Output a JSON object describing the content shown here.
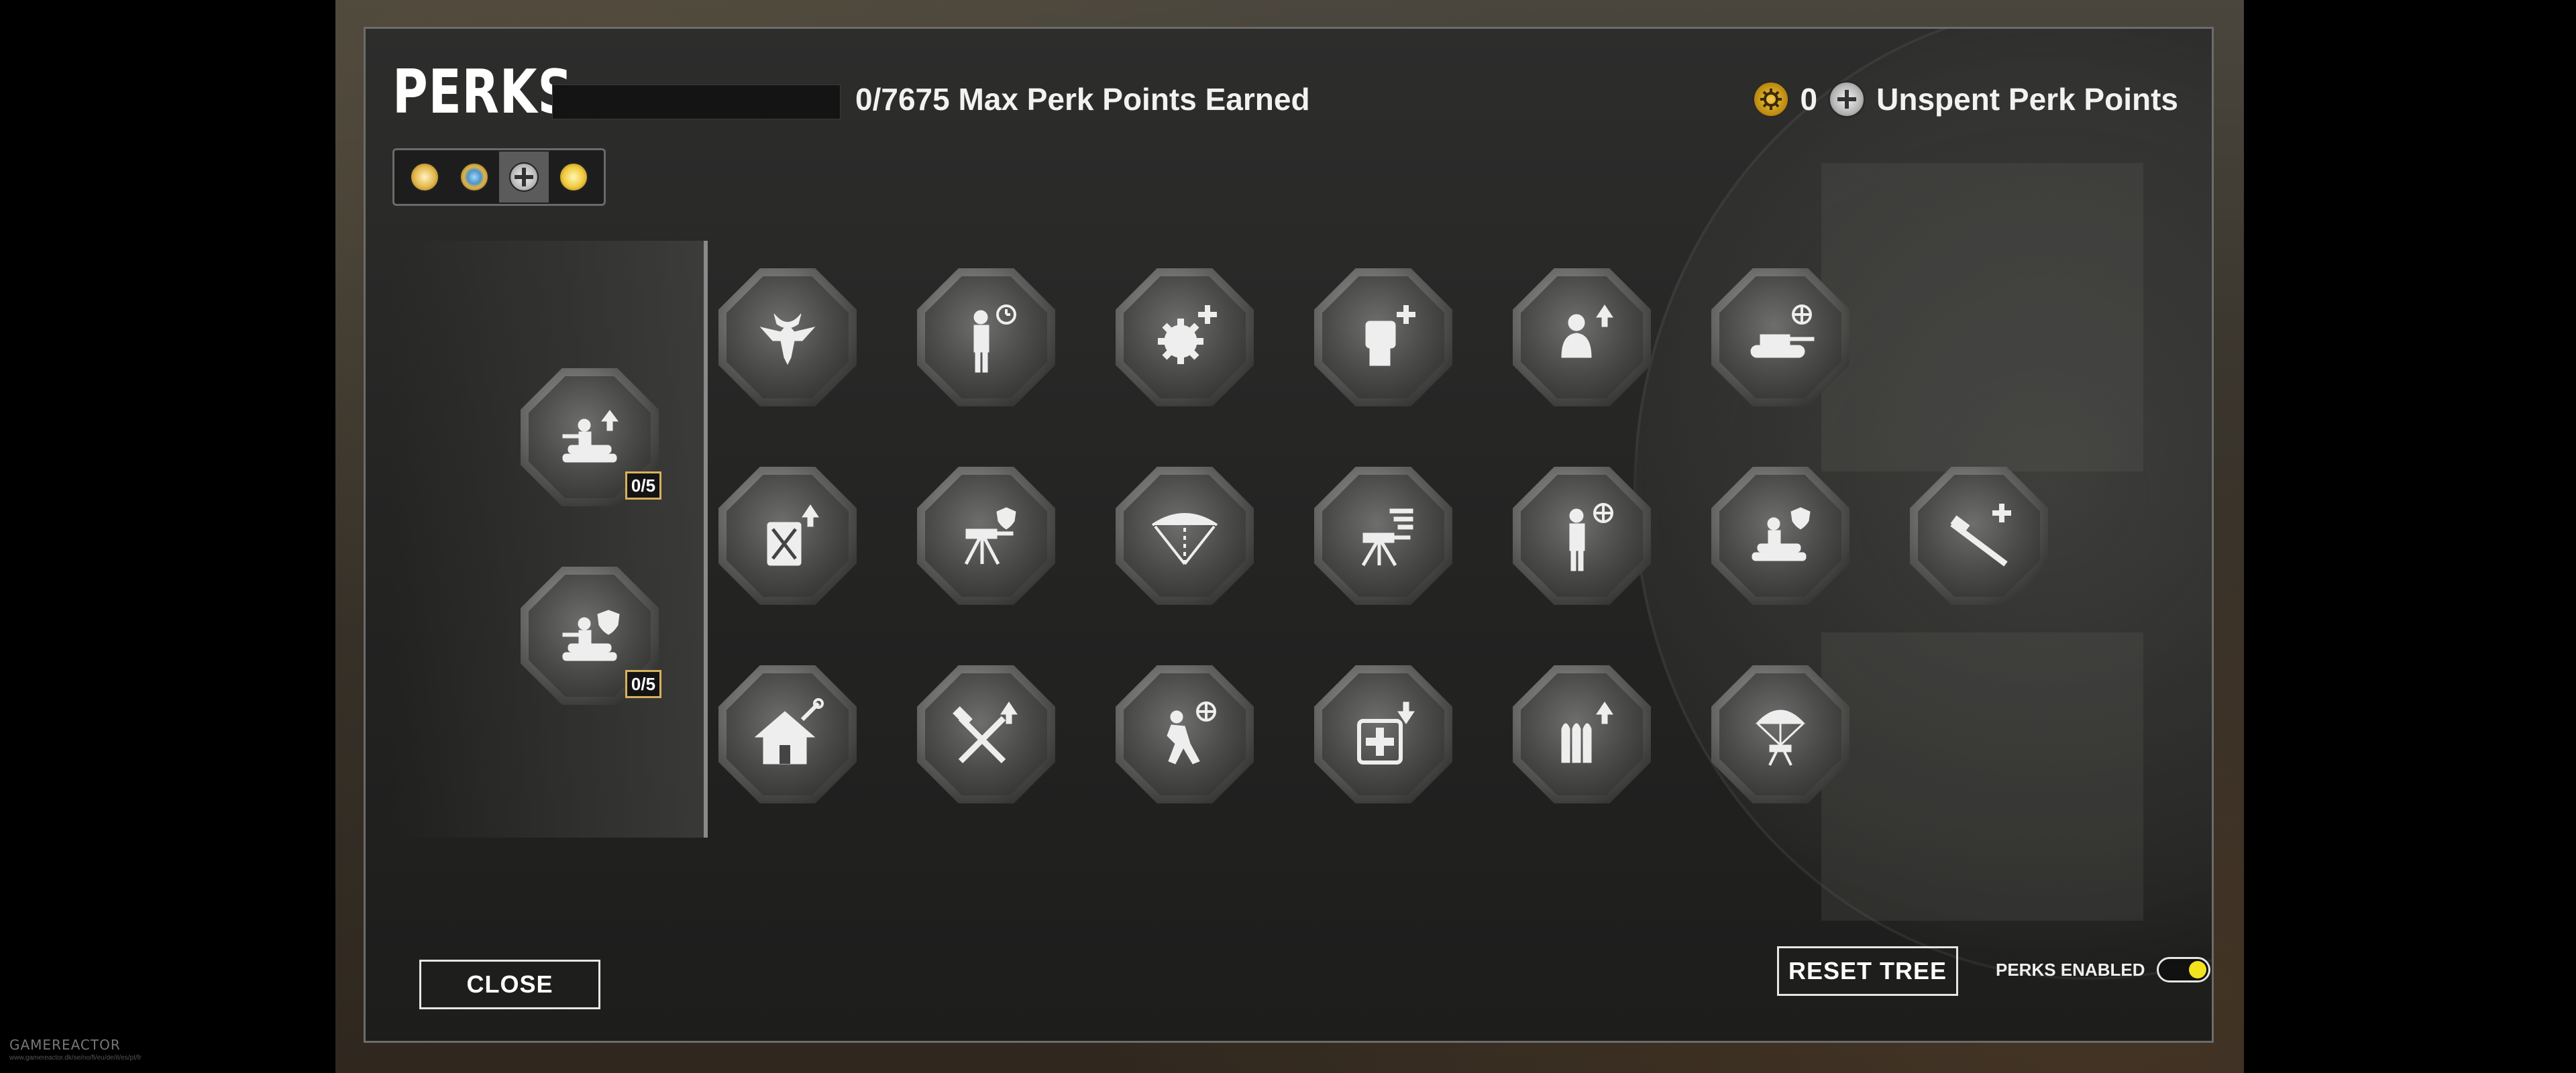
{
  "header": {
    "title": "PERKS",
    "progress_text": "0/7675 Max Perk Points Earned",
    "progress_fraction": 0,
    "general_points": "0",
    "unspent_label": "Unspent Perk Points"
  },
  "faction_tabs": [
    {
      "name": "faction-1",
      "active": false
    },
    {
      "name": "faction-2",
      "active": false
    },
    {
      "name": "faction-3",
      "active": true
    },
    {
      "name": "faction-4",
      "active": false
    }
  ],
  "sidebar_perks": [
    {
      "icon": "sandbag-soldier-upgrade-icon",
      "count": "0/5"
    },
    {
      "icon": "sandbag-soldier-shield-icon",
      "count": "0/5"
    }
  ],
  "perk_grid": {
    "row1": [
      "eagle-emblem-icon",
      "soldier-timer-icon",
      "gear-plus-icon",
      "fist-plus-icon",
      "soldier-upgrade-icon",
      "tank-target-icon"
    ],
    "row2": [
      "fuel-can-upgrade-icon",
      "machine-gun-shield-icon",
      "arc-range-icon",
      "machine-gun-speed-icon",
      "soldier-target-icon",
      "sandbag-shield-icon",
      "rifle-plus-icon"
    ],
    "row3": [
      "house-repair-icon",
      "tools-upgrade-icon",
      "runner-target-icon",
      "medkit-download-icon",
      "ammo-upgrade-icon",
      "parachute-gun-icon"
    ]
  },
  "footer": {
    "close_label": "CLOSE",
    "reset_label": "RESET TREE",
    "perks_enabled_label": "PERKS ENABLED",
    "perks_enabled": true
  },
  "watermark": "GAMEREACTOR",
  "watermark_url": "www.gamereactor.dk/se/no/fi/eu/de/it/es/pt/fr",
  "colors": {
    "accent_gold": "#d8b25a",
    "toggle_on": "#f3e21e",
    "panel_bg": "#242423"
  }
}
